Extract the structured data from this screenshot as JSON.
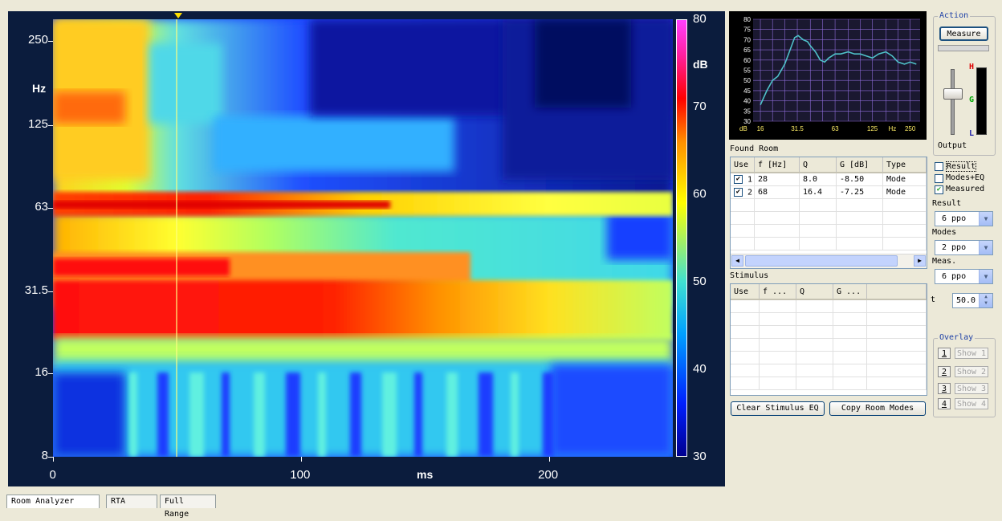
{
  "waterfall": {
    "y_ticks": [
      "250",
      "125",
      "63",
      "31.5",
      "16",
      "8"
    ],
    "y_unit": "Hz",
    "x_ticks": [
      "0",
      "100",
      "200"
    ],
    "x_unit": "ms",
    "cbar_ticks": [
      "80",
      "70",
      "60",
      "50",
      "40",
      "30"
    ],
    "cbar_unit": "dB"
  },
  "chart_data": {
    "type": "heatmap",
    "title": "",
    "xlabel": "ms",
    "ylabel": "Hz",
    "x_range": [
      0,
      250
    ],
    "y_range": [
      8,
      300
    ],
    "y_scale": "log",
    "color_range_db": [
      30,
      80
    ],
    "cursor_ms": 50
  },
  "mini_chart": {
    "y_ticks": [
      "80",
      "75",
      "70",
      "65",
      "60",
      "55",
      "50",
      "45",
      "40",
      "35",
      "30"
    ],
    "x_ticks": [
      "16",
      "31.5",
      "63",
      "125",
      "250"
    ],
    "x_unit": "Hz",
    "y_unit": "dB"
  },
  "mini_chart_data": {
    "type": "line",
    "x": [
      16,
      18,
      20,
      22,
      25,
      28,
      30,
      32,
      35,
      38,
      40,
      44,
      48,
      52,
      56,
      63,
      70,
      80,
      90,
      100,
      112,
      125,
      140,
      160,
      180,
      200,
      225,
      250,
      280
    ],
    "values": [
      38,
      45,
      50,
      52,
      58,
      66,
      71,
      72,
      70,
      69,
      67,
      64,
      60,
      59,
      61,
      63,
      63,
      64,
      63,
      63,
      62,
      61,
      63,
      64,
      62,
      59,
      58,
      59,
      58
    ],
    "ylim": [
      30,
      80
    ]
  },
  "found_room": {
    "title": "Found Room",
    "columns": [
      "Use",
      "f [Hz]",
      "Q",
      "G [dB]",
      "Type"
    ],
    "rows": [
      {
        "use": "1",
        "f": "28",
        "q": "8.0",
        "g": "-8.50",
        "type": "Mode"
      },
      {
        "use": "2",
        "f": "68",
        "q": "16.4",
        "g": "-7.25",
        "type": "Mode"
      }
    ]
  },
  "stimulus": {
    "title": "Stimulus",
    "columns": [
      "Use",
      "f ...",
      "Q",
      "G ..."
    ]
  },
  "buttons": {
    "clear_stimulus": "Clear Stimulus EQ",
    "copy_room": "Copy Room Modes",
    "measure": "Measure"
  },
  "action": {
    "title": "Action",
    "output_label": "Output",
    "meter_h": "H",
    "meter_g": "G",
    "meter_l": "L"
  },
  "display": {
    "result_label": "Result",
    "modes_eq_label": "Modes+EQ",
    "measured_label": "Measured",
    "measured_checked": true
  },
  "combos": {
    "result_label": "Result",
    "result_value": "6 ppo",
    "modes_label": "Modes",
    "modes_value": "2 ppo",
    "meas_label": "Meas.",
    "meas_value": "6 ppo",
    "t_label": "t",
    "t_value": "50.0"
  },
  "overlay": {
    "title": "Overlay",
    "items": [
      {
        "num": "1",
        "show": "Show 1"
      },
      {
        "num": "2",
        "show": "Show 2"
      },
      {
        "num": "3",
        "show": "Show 3"
      },
      {
        "num": "4",
        "show": "Show 4"
      }
    ]
  },
  "tabs": [
    "Room Analyzer",
    "RTA",
    "Full Range"
  ],
  "colors": {
    "plot_bg": "#0b1c3d",
    "curve": "#4fc1c9",
    "grid": "#8d6bd8"
  }
}
